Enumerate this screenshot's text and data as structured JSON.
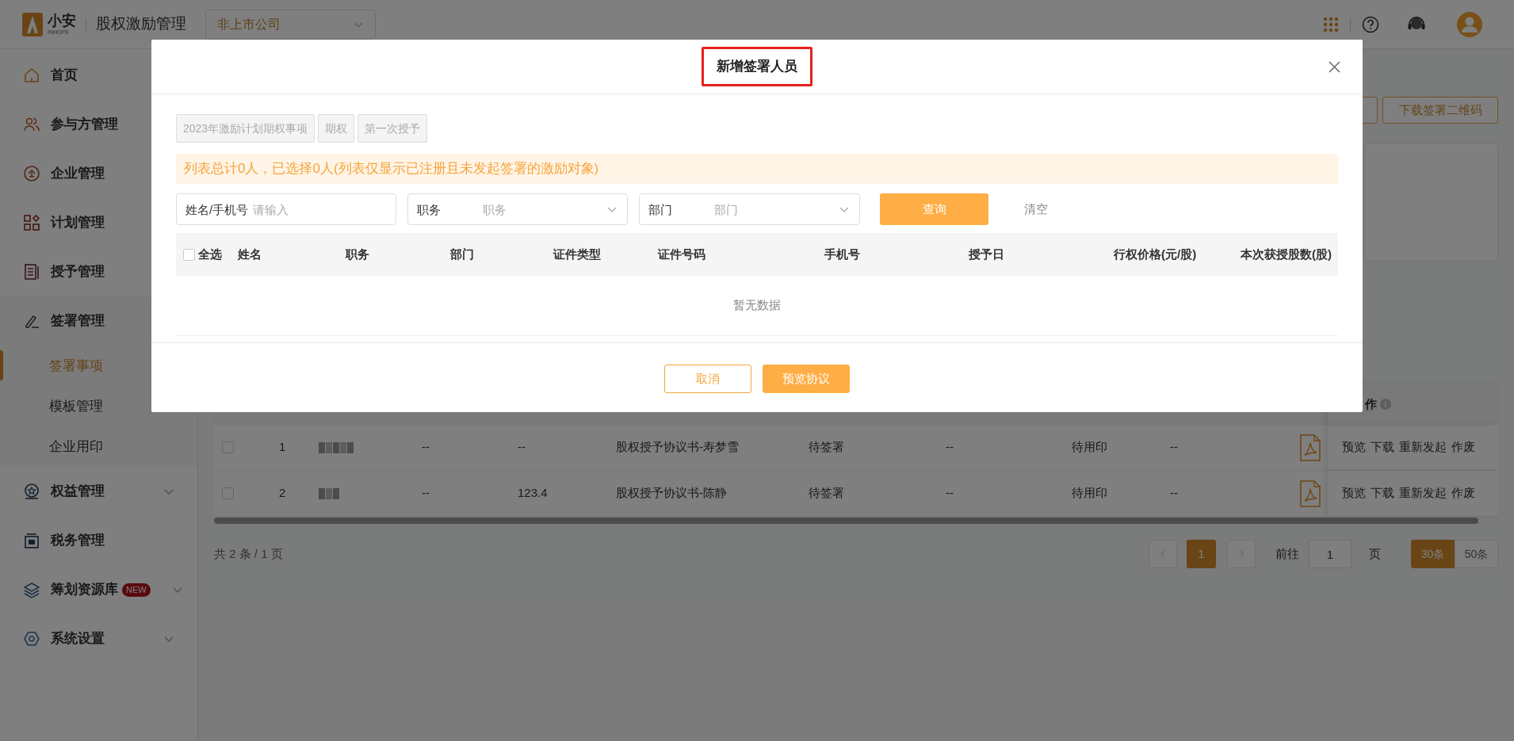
{
  "header": {
    "logo_text": "小安",
    "logo_subtext": "INHOPE",
    "app_title": "股权激励管理",
    "company_select": "非上市公司"
  },
  "sidebar": {
    "items": [
      {
        "label": "首页",
        "kind": "link"
      },
      {
        "label": "参与方管理",
        "kind": "link"
      },
      {
        "label": "企业管理",
        "kind": "link"
      },
      {
        "label": "计划管理",
        "kind": "link"
      },
      {
        "label": "授予管理",
        "kind": "link"
      },
      {
        "label": "签署管理",
        "kind": "open-group",
        "expanded": true,
        "children": [
          {
            "label": "签署事项",
            "selected": true
          },
          {
            "label": "模板管理",
            "selected": false
          },
          {
            "label": "企业用印",
            "selected": false
          }
        ]
      },
      {
        "label": "权益管理",
        "kind": "group",
        "expanded": false
      },
      {
        "label": "税务管理",
        "kind": "link"
      },
      {
        "label": "筹划资源库",
        "kind": "group",
        "expanded": false,
        "badge": "NEW"
      },
      {
        "label": "系统设置",
        "kind": "group",
        "expanded": false
      }
    ]
  },
  "page": {
    "top_button": "下载签署二维码"
  },
  "records_table": {
    "header_fixed": "作",
    "rows": [
      {
        "checked": false,
        "index": "1",
        "col_3": "--",
        "col_4": "--",
        "document": "股权授予协议书-寿梦雪",
        "status": "待签署",
        "col_7": "--",
        "seal_status": "待用印",
        "col_9": "--",
        "actions": [
          "预览",
          "下载",
          "重新发起",
          "作废"
        ]
      },
      {
        "checked": false,
        "index": "2",
        "col_3": "--",
        "col_4": "123.4",
        "document": "股权授予协议书-陈静",
        "status": "待签署",
        "col_7": "--",
        "seal_status": "待用印",
        "col_9": "--",
        "actions": [
          "预览",
          "下载",
          "重新发起",
          "作废"
        ]
      }
    ]
  },
  "pagination": {
    "summary": "共 2 条 / 1 页",
    "pages": [
      {
        "label": "1",
        "selected": true
      }
    ],
    "goto_label": "前往",
    "goto_value": "1",
    "page_unit": "页",
    "page_sizes": [
      {
        "label": "30条",
        "selected": true
      },
      {
        "label": "50条",
        "selected": false
      }
    ]
  },
  "dialog": {
    "title": "新增签署人员",
    "tags": [
      "2023年激励计划期权事项",
      "期权",
      "第一次授予"
    ],
    "notice": "列表总计0人，已选择0人(列表仅显示已注册且未发起签署的激励对象)",
    "filters": [
      {
        "kind": "input",
        "label": "姓名/手机号",
        "placeholder": "请输入"
      },
      {
        "kind": "select",
        "label": "职务",
        "placeholder": "职务"
      },
      {
        "kind": "select",
        "label": "部门",
        "placeholder": "部门"
      }
    ],
    "search_button": "查询",
    "clear_button": "清空",
    "table": {
      "select_all": {
        "label": "全选",
        "checked": false
      },
      "columns": [
        "姓名",
        "职务",
        "部门",
        "证件类型",
        "证件号码",
        "手机号",
        "授予日",
        "行权价格(元/股)",
        "本次获授股数(股)"
      ],
      "empty_text": "暂无数据"
    },
    "buttons": [
      {
        "label": "取消",
        "kind": "secondary"
      },
      {
        "label": "预览协议",
        "kind": "primary"
      }
    ]
  }
}
